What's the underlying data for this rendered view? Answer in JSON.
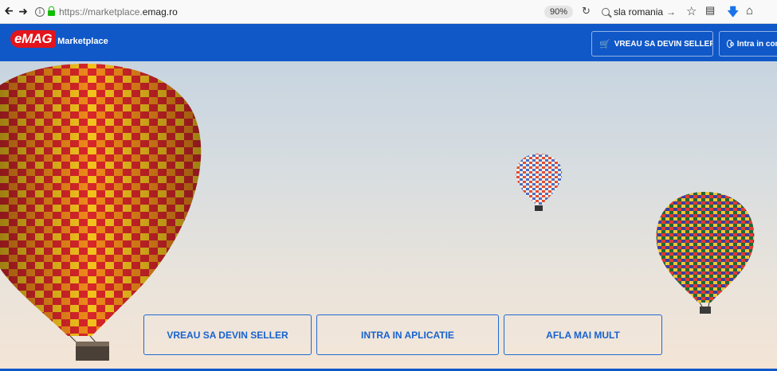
{
  "browser": {
    "url_prefix": "https://marketplace.",
    "url_domain": "emag.ro",
    "zoom": "90%",
    "search_text": "sla romania",
    "icons": [
      "back-icon",
      "forward-icon",
      "info-icon",
      "lock-icon",
      "reload-icon",
      "search-icon",
      "star-icon",
      "reader-icon",
      "download-icon",
      "home-icon"
    ]
  },
  "header": {
    "logo_text": "eMAG",
    "logo_subtext": "Marketplace",
    "seller_button": "VREAU SA DEVIN SELLER",
    "login_button": "Intra in cont",
    "brand_color": "#1058c8",
    "logo_color": "#e3141b"
  },
  "hero": {
    "cta_seller": "VREAU SA DEVIN SELLER",
    "cta_app": "INTRA IN APLICATIE",
    "cta_more": "AFLA MAI MULT"
  }
}
